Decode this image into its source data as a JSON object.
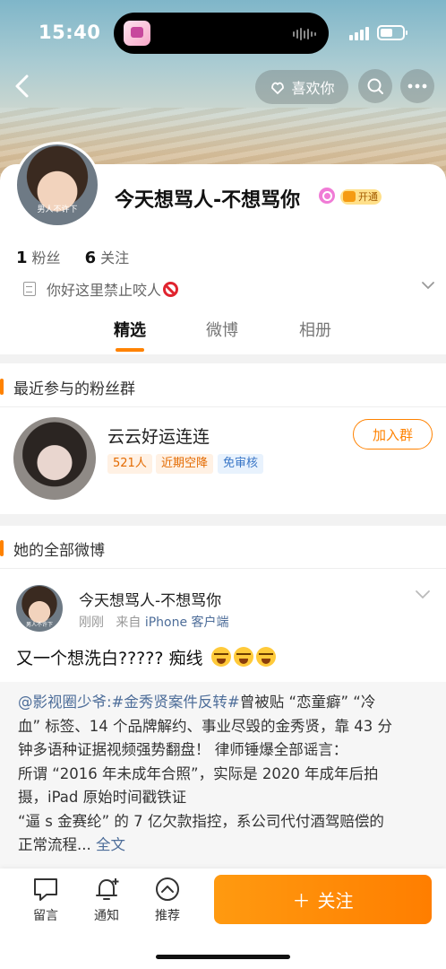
{
  "status_bar": {
    "time": "15:40"
  },
  "header": {
    "like_label": "喜欢你"
  },
  "profile": {
    "avatar_caption": "男人不许下",
    "name": "今天想骂人-不想骂你",
    "vip_label": "开通",
    "fans_count": "1",
    "fans_label": "粉丝",
    "following_count": "6",
    "following_label": "关注",
    "bio": "你好这里禁止咬人"
  },
  "tabs": [
    "精选",
    "微博",
    "相册"
  ],
  "fan_groups": {
    "title": "最近参与的粉丝群",
    "group_name": "云云好运连连",
    "tags": [
      "521人",
      "近期空降",
      "免审核"
    ],
    "join_label": "加入群"
  },
  "posts_section": {
    "title": "她的全部微博",
    "post": {
      "author": "今天想骂人-不想骂你",
      "avatar_caption": "男人不许下",
      "time": "刚刚",
      "from_prefix": "来自",
      "source": "iPhone 客户端",
      "text": "又一个想洗白?????  痴线",
      "retweet": {
        "link": "@影视圈少爷:#金秀贤案件反转#",
        "line1": "曾被贴 “恋童癖” “冷",
        "line2": "血” 标签、14 个品牌解约、事业尽毁的金秀贤，靠 43 分",
        "line3": "钟多语种证据视频强势翻盘！ 律师锤爆全部谣言：",
        "line4": "所谓 “2016 年未成年合照”，实际是 2020 年成年后拍",
        "line5": "摄，iPad 原始时间戳铁证",
        "line6": "“逼 s 金赛纶” 的 7 亿欠款指控，系公司代付酒驾赔偿的",
        "line7": "正常流程...",
        "full_text": "全文"
      }
    }
  },
  "bottom_bar": {
    "comment_label": "留言",
    "notify_label": "通知",
    "recommend_label": "推荐",
    "follow_label": "关注"
  },
  "colors": {
    "accent": "#ff8200",
    "link": "#4d6d99"
  }
}
